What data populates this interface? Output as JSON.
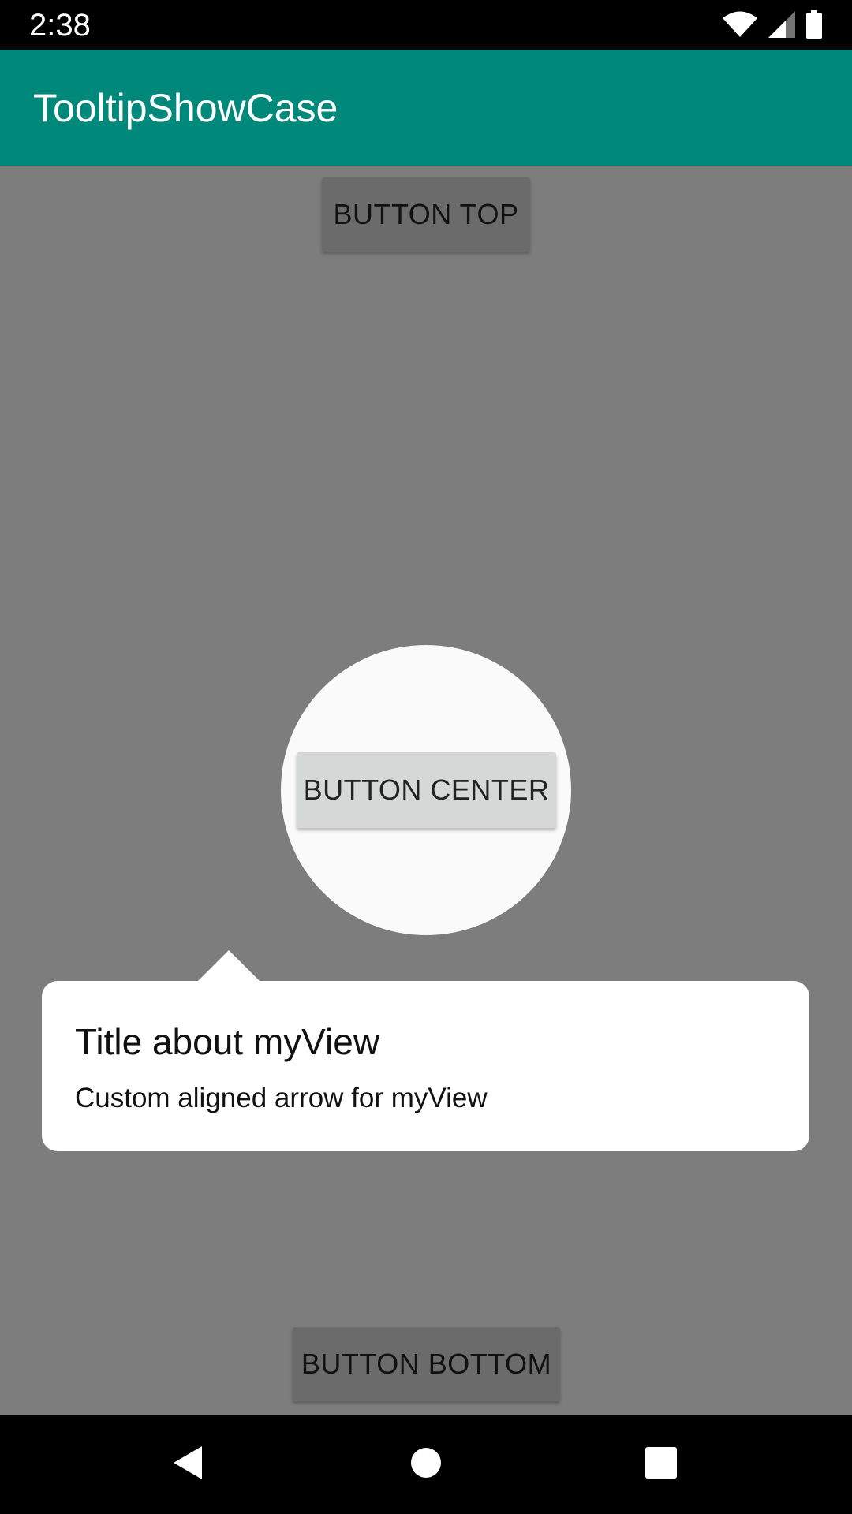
{
  "status_bar": {
    "time": "2:38",
    "icons": [
      "wifi-icon",
      "cell-signal-icon",
      "battery-icon"
    ]
  },
  "app_bar": {
    "title": "TooltipShowCase",
    "color": "#00897b"
  },
  "content": {
    "button_top": "BUTTON TOP",
    "button_center": "BUTTON CENTER",
    "button_bottom": "BUTTON BOTTOM"
  },
  "tooltip": {
    "title": "Title about myView",
    "description": "Custom aligned arrow for myView"
  },
  "overlay": {
    "color": "#808080"
  },
  "nav_bar": {
    "icons": [
      "back-icon",
      "home-icon",
      "recents-icon"
    ]
  }
}
